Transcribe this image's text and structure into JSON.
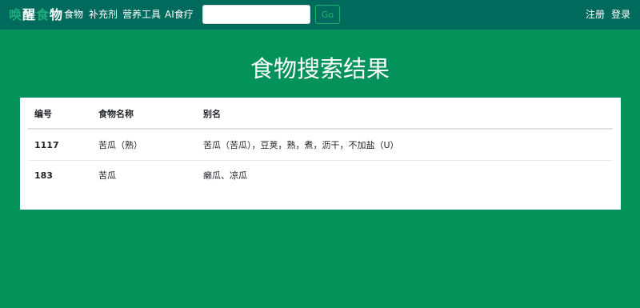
{
  "nav": {
    "brand_part1": "唤",
    "brand_part2": "醒",
    "brand_part3": "食",
    "brand_part4": "物",
    "items": [
      "食物",
      "补充剂",
      "营养工具",
      "AI食疗"
    ],
    "search": {
      "value": "",
      "placeholder": ""
    },
    "go_label": "Go",
    "register": "注册",
    "login": "登录"
  },
  "page": {
    "title": "食物搜索结果"
  },
  "table": {
    "headers": [
      "编号",
      "食物名称",
      "别名"
    ],
    "rows": [
      {
        "id": "1117",
        "name": "苦瓜（熟）",
        "alias": "苦瓜（苦瓜），豆荚，熟，煮，沥干，不加盐（U）"
      },
      {
        "id": "183",
        "name": "苦瓜",
        "alias": "癞瓜、凉瓜"
      }
    ]
  },
  "colors": {
    "navbar": "#006b5c",
    "background": "#03925a",
    "go_button": "#18b46b"
  }
}
